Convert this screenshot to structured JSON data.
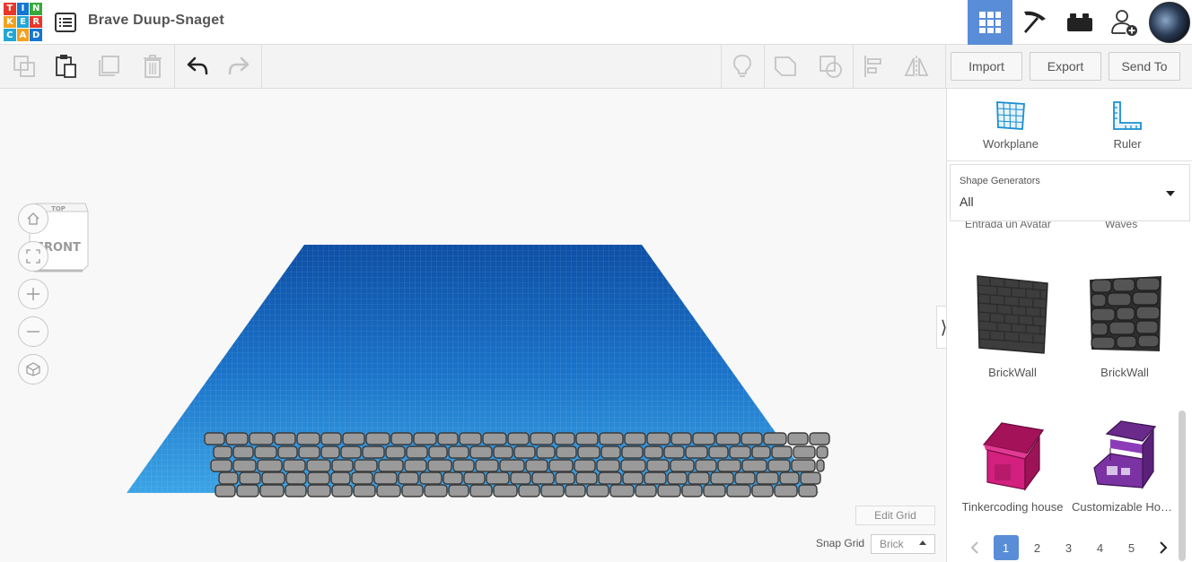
{
  "app": {
    "logo_letters": [
      "T",
      "I",
      "N",
      "K",
      "E",
      "R",
      "C",
      "A",
      "D"
    ],
    "design_title": "Brave Duup-Snaget"
  },
  "topnav": {
    "items": [
      {
        "name": "3d-design-view",
        "icon": "grid-icon",
        "active": true
      },
      {
        "name": "blocks-view",
        "icon": "pickaxe-icon",
        "active": false
      },
      {
        "name": "bricks-view",
        "icon": "brick-icon",
        "active": false
      },
      {
        "name": "invite-user",
        "icon": "add-user-icon",
        "active": false
      },
      {
        "name": "user-avatar",
        "icon": "avatar",
        "active": false
      }
    ]
  },
  "toolbar": {
    "icons": [
      "copy-icon",
      "paste-icon",
      "duplicate-icon",
      "delete-icon",
      "undo-icon",
      "redo-icon",
      "lightbulb-icon",
      "group-icon",
      "ungroup-icon",
      "align-icon",
      "mirror-icon"
    ],
    "import_label": "Import",
    "export_label": "Export",
    "send_to_label": "Send To"
  },
  "viewcube": {
    "top_label": "TOP",
    "front_label": "FRONT"
  },
  "viewport": {
    "edit_grid_label": "Edit Grid",
    "snap_grid_label": "Snap Grid",
    "snap_grid_value": "Brick",
    "workplane_color": "#2d8fd8",
    "brick_color": "#9a9a9a"
  },
  "panel": {
    "tools": [
      {
        "label": "Workplane",
        "icon": "workplane-icon"
      },
      {
        "label": "Ruler",
        "icon": "ruler-icon"
      }
    ],
    "generator": {
      "title": "Shape Generators",
      "value": "All"
    },
    "clipped_labels": [
      "Entrada un Avatar",
      "Waves"
    ],
    "shapes": [
      {
        "label": "BrickWall",
        "color": "#3c3c3c"
      },
      {
        "label": "BrickWall",
        "color": "#3c3c3c"
      },
      {
        "label": "Tinkercoding house",
        "color": "#c2186b"
      },
      {
        "label": "Customizable House",
        "color": "#6c2d8c"
      }
    ],
    "pager": {
      "pages": [
        "1",
        "2",
        "3",
        "4",
        "5"
      ],
      "current": "1"
    }
  }
}
